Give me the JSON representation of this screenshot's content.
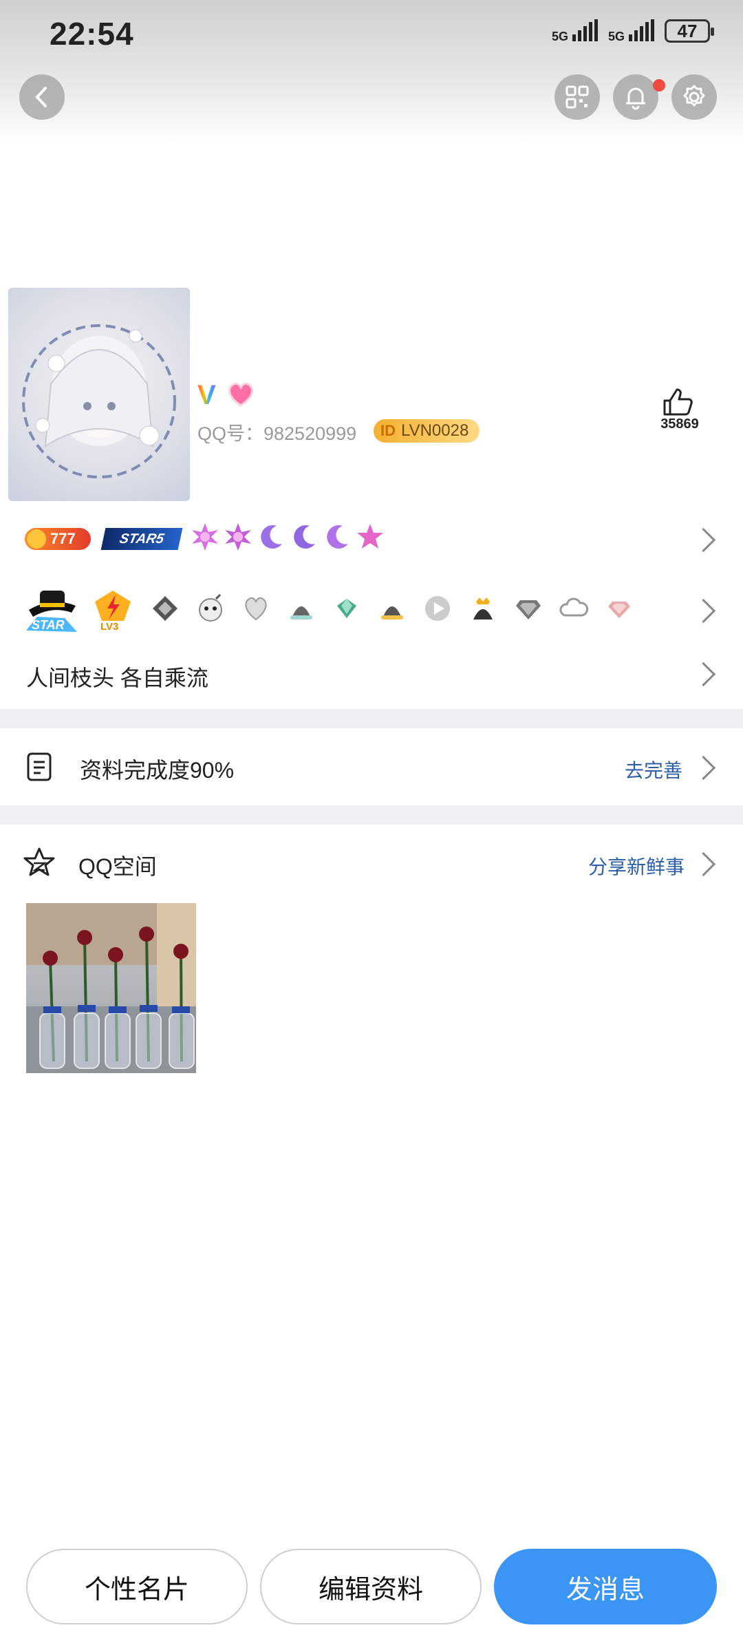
{
  "status_bar": {
    "time": "22:54",
    "network1": "5G",
    "network2": "5G",
    "battery": "47"
  },
  "header": {
    "back_icon": "chevron-left-icon",
    "qr_icon": "qr-code-icon",
    "bell_icon": "bell-icon",
    "settings_icon": "gear-icon",
    "notification_dot_color": "#ef4b3e"
  },
  "profile": {
    "vip_mark": "V",
    "qq_number_label": "QQ号：982520999",
    "id_badge_mark": "ID",
    "id_badge_text": "LVN0028",
    "like_count": "35869"
  },
  "badges_row1": {
    "coin_value": "777",
    "star_label": "STAR5"
  },
  "badges_row2": {
    "star_level": "STAR",
    "lv_label": "LV3"
  },
  "signature": "人间枝头 各自乘流",
  "completion": {
    "label": "资料完成度90%",
    "action": "去完善"
  },
  "qzone": {
    "title": "QQ空间",
    "action": "分享新鲜事"
  },
  "buttons": {
    "card": "个性名片",
    "edit": "编辑资料",
    "message": "发消息"
  },
  "colors": {
    "primary": "#3b95f5",
    "link": "#2d5ea8",
    "badge_gold": "#f5b030"
  }
}
